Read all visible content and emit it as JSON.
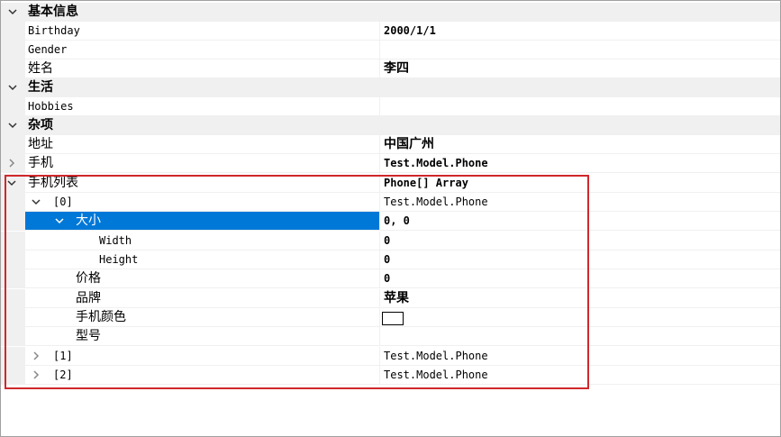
{
  "categories": {
    "basic": "基本信息",
    "life": "生活",
    "misc": "杂项"
  },
  "rows": {
    "birthday": {
      "name": "Birthday",
      "value": "2000/1/1"
    },
    "gender": {
      "name": "Gender",
      "value": ""
    },
    "xingming": {
      "name": "姓名",
      "value": "李四"
    },
    "hobbies": {
      "name": "Hobbies",
      "value": ""
    },
    "address": {
      "name": "地址",
      "value": "中国广州"
    },
    "phone": {
      "name": "手机",
      "value": "Test.Model.Phone"
    },
    "phone_list": {
      "name": "手机列表",
      "value": "Phone[] Array"
    },
    "item0": {
      "name": "[0]",
      "value": "Test.Model.Phone"
    },
    "size": {
      "name": "大小",
      "value": "0, 0"
    },
    "width": {
      "name": "Width",
      "value": "0"
    },
    "height": {
      "name": "Height",
      "value": "0"
    },
    "price": {
      "name": "价格",
      "value": "0"
    },
    "brand": {
      "name": "品牌",
      "value": "苹果"
    },
    "color": {
      "name": "手机颜色",
      "value": ""
    },
    "model": {
      "name": "型号",
      "value": ""
    },
    "item1": {
      "name": "[1]",
      "value": "Test.Model.Phone"
    },
    "item2": {
      "name": "[2]",
      "value": "Test.Model.Phone"
    }
  },
  "colors": {
    "selection": "#0078d7",
    "highlight_box": "#d0282c",
    "category_bg": "#f0f0f0"
  },
  "icons": {
    "expanded": "chevron-down-icon",
    "collapsed": "chevron-right-icon"
  }
}
